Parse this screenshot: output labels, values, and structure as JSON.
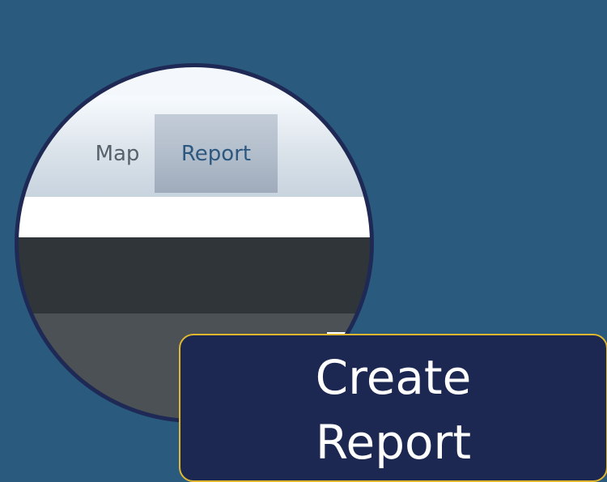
{
  "nav": {
    "tabs": [
      {
        "label": "Map"
      },
      {
        "label": "Report"
      }
    ]
  },
  "callout": {
    "lines": [
      "Create",
      "Report"
    ]
  },
  "colors": {
    "background": "#2a5a7d",
    "magnifier_border": "#1e2a55",
    "callout_background": "#1d2852",
    "callout_border": "#e0b82f",
    "active_tab_text": "#2c587f",
    "inactive_tab_text": "#56616b"
  }
}
